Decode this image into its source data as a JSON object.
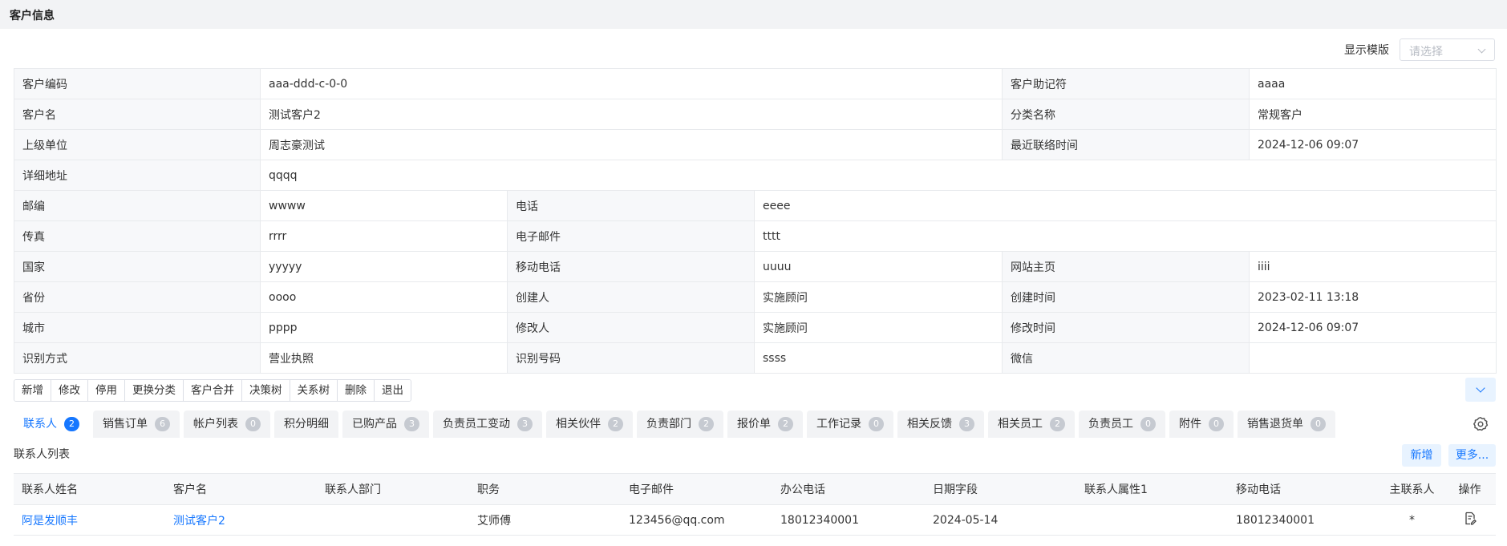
{
  "page": {
    "title": "客户信息"
  },
  "template_select": {
    "label": "显示模版",
    "placeholder": "请选择"
  },
  "info": {
    "customer_code": {
      "label": "客户编码",
      "value": "aaa-ddd-c-0-0"
    },
    "mnemonic": {
      "label": "客户助记符",
      "value": "aaaa"
    },
    "customer_name": {
      "label": "客户名",
      "value": "测试客户2"
    },
    "category": {
      "label": "分类名称",
      "value": "常规客户"
    },
    "parent_unit": {
      "label": "上级单位",
      "value": "周志豪测试"
    },
    "last_contact": {
      "label": "最近联络时间",
      "value": "2024-12-06 09:07"
    },
    "address": {
      "label": "详细地址",
      "value": "qqqq"
    },
    "postcode": {
      "label": "邮编",
      "value": "wwww"
    },
    "phone": {
      "label": "电话",
      "value": "eeee"
    },
    "fax": {
      "label": "传真",
      "value": "rrrr"
    },
    "email": {
      "label": "电子邮件",
      "value": "tttt"
    },
    "country": {
      "label": "国家",
      "value": "yyyyy"
    },
    "mobile": {
      "label": "移动电话",
      "value": "uuuu"
    },
    "website": {
      "label": "网站主页",
      "value": "iiii"
    },
    "province": {
      "label": "省份",
      "value": "oooo"
    },
    "creator": {
      "label": "创建人",
      "value": "实施顾问"
    },
    "created_at": {
      "label": "创建时间",
      "value": "2023-02-11 13:18"
    },
    "city": {
      "label": "城市",
      "value": "pppp"
    },
    "modifier": {
      "label": "修改人",
      "value": "实施顾问"
    },
    "modified_at": {
      "label": "修改时间",
      "value": "2024-12-06 09:07"
    },
    "id_method": {
      "label": "识别方式",
      "value": "营业执照"
    },
    "id_number": {
      "label": "识别号码",
      "value": "ssss"
    },
    "wechat": {
      "label": "微信",
      "value": ""
    }
  },
  "toolbar": [
    "新增",
    "修改",
    "停用",
    "更换分类",
    "客户合并",
    "决策树",
    "关系树",
    "删除",
    "退出"
  ],
  "tabs": [
    {
      "label": "联系人",
      "count": "2"
    },
    {
      "label": "销售订单",
      "count": "6"
    },
    {
      "label": "帐户列表",
      "count": "0"
    },
    {
      "label": "积分明细",
      "count": ""
    },
    {
      "label": "已购产品",
      "count": "3"
    },
    {
      "label": "负责员工变动",
      "count": "3"
    },
    {
      "label": "相关伙伴",
      "count": "2"
    },
    {
      "label": "负责部门",
      "count": "2"
    },
    {
      "label": "报价单",
      "count": "2"
    },
    {
      "label": "工作记录",
      "count": "0"
    },
    {
      "label": "相关反馈",
      "count": "3"
    },
    {
      "label": "相关员工",
      "count": "2"
    },
    {
      "label": "负责员工",
      "count": "0"
    },
    {
      "label": "附件",
      "count": "0"
    },
    {
      "label": "销售退货单",
      "count": "0"
    }
  ],
  "contacts": {
    "title": "联系人列表",
    "add_label": "新增",
    "more_label": "更多...",
    "columns": [
      "联系人姓名",
      "客户名",
      "联系人部门",
      "职务",
      "电子邮件",
      "办公电话",
      "日期字段",
      "联系人属性1",
      "移动电话",
      "主联系人",
      "操作"
    ],
    "rows": [
      [
        "阿是发顺丰",
        "测试客户2",
        "",
        "艾师傅",
        "123456@qq.com",
        "18012340001",
        "2024-05-14",
        "",
        "18012340001",
        "*",
        ""
      ]
    ]
  },
  "colors": {
    "primary": "#1677ff",
    "label_bg": "#f7f8fa",
    "header_bg": "#f2f3f5"
  },
  "icons": {
    "tab_settings": "gear-icon",
    "collapse": "chevron-down-icon",
    "row_action": "document-edit-icon"
  }
}
